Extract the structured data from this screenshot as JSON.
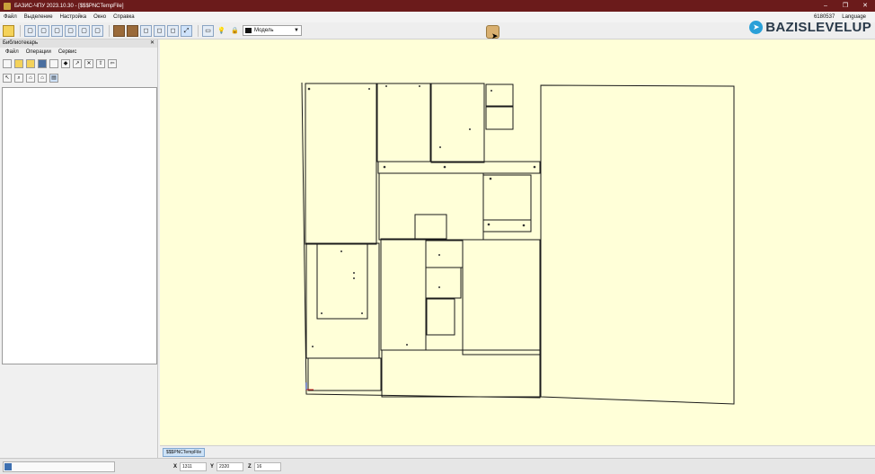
{
  "window": {
    "title": "БАЗИС-ЧПУ 2023.10.30 - [$$$PNCTempFile]"
  },
  "menu": {
    "items": [
      "Файл",
      "Выделение",
      "Настройка",
      "Окно",
      "Справка"
    ],
    "code": "6180537",
    "language": "Language"
  },
  "toolbar": {
    "layer_select": "Модель"
  },
  "watermark": {
    "text": "BAZISLEVELUP"
  },
  "library": {
    "title": "Библиотекарь",
    "menu": [
      "Файл",
      "Операции",
      "Сервис"
    ]
  },
  "tabs": {
    "active": "$$$PNCTempFile"
  },
  "status": {
    "x_label": "X",
    "x_value": "1311",
    "y_label": "Y",
    "y_value": "2320",
    "z_label": "Z",
    "z_value": "16"
  },
  "colors": {
    "canvas": "#ffffd8",
    "titlebar": "#6b1b1b",
    "accent": "#2aa0d8"
  }
}
